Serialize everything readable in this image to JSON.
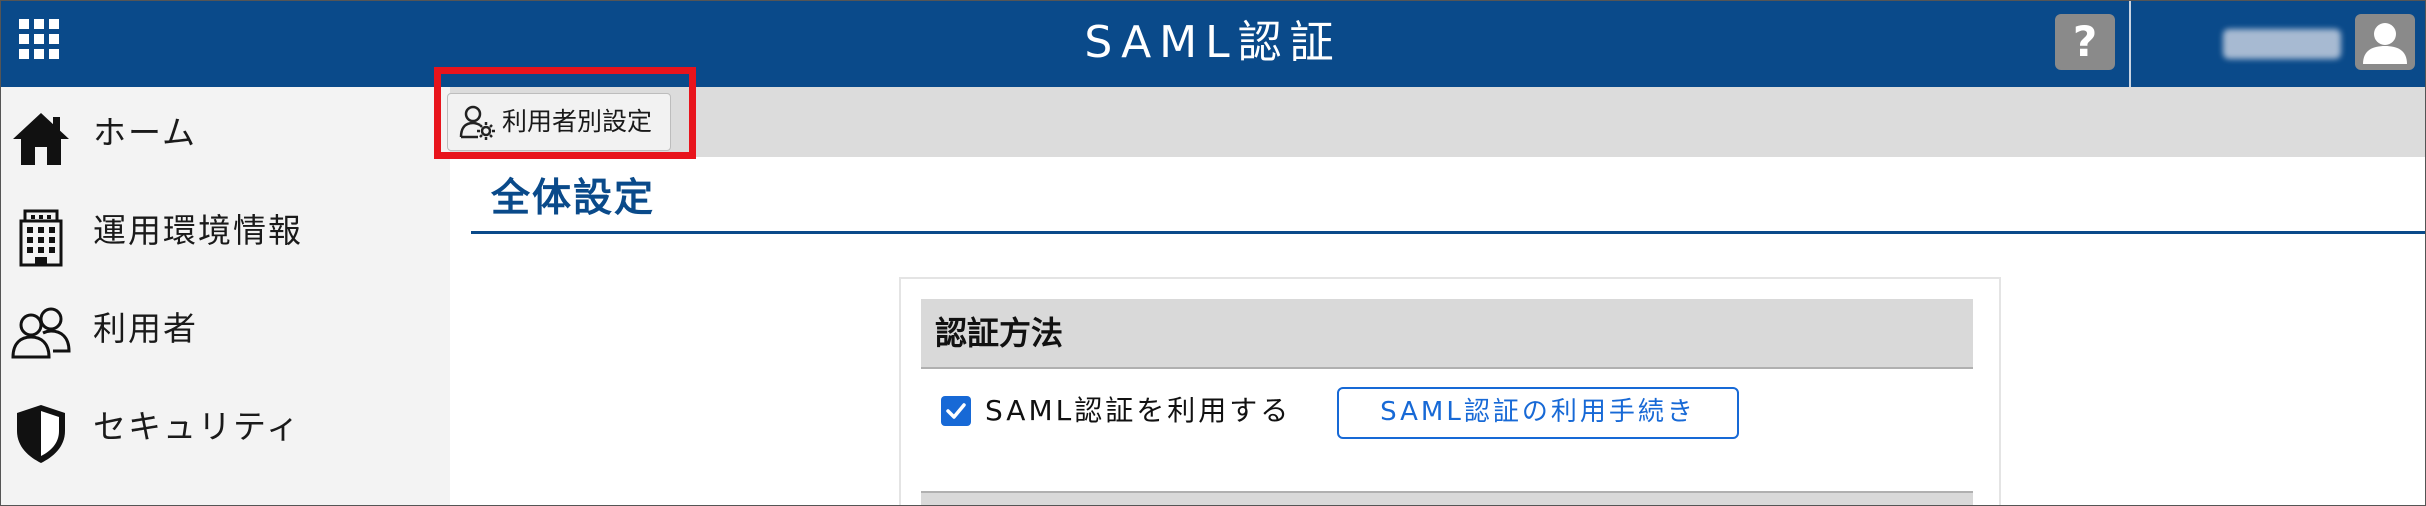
{
  "header": {
    "title": "SAML認証",
    "help_label": "?",
    "icons": {
      "apps": "apps-grid-icon",
      "help": "help-icon",
      "avatar": "user-avatar-icon"
    }
  },
  "sidebar": {
    "items": [
      {
        "label": "ホーム",
        "icon": "home-icon"
      },
      {
        "label": "運用環境情報",
        "icon": "building-icon"
      },
      {
        "label": "利用者",
        "icon": "users-icon"
      },
      {
        "label": "セキュリティ",
        "icon": "shield-icon"
      }
    ]
  },
  "toolbar": {
    "user_settings_label": "利用者別設定",
    "user_settings_icon": "user-gear-icon"
  },
  "main": {
    "page_title": "全体設定",
    "auth_section": {
      "title": "認証方法",
      "saml_checkbox_label": "SAML認証を利用する",
      "saml_checkbox_checked": true,
      "saml_procedure_button": "SAML認証の利用手続き"
    }
  },
  "colors": {
    "header_bg": "#0a4a8a",
    "accent_blue": "#1769d6",
    "highlight_red": "#e8141c",
    "sidebar_bg": "#f3f3f3",
    "toolbar_bg": "#dcdcdc"
  }
}
